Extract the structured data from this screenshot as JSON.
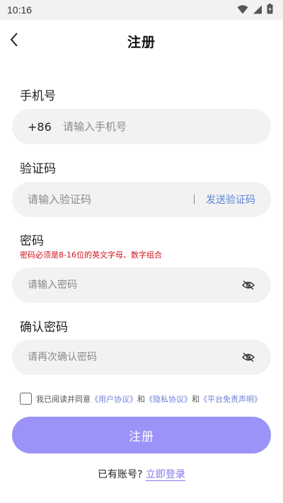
{
  "status_bar": {
    "time": "10:16",
    "icons": [
      "wifi-icon",
      "cellular-signal-icon",
      "battery-icon"
    ]
  },
  "header": {
    "title": "注册",
    "back_icon": "chevron-left-icon"
  },
  "phone": {
    "label": "手机号",
    "country_code": "+86",
    "placeholder": "请输入手机号",
    "value": ""
  },
  "code": {
    "label": "验证码",
    "placeholder": "请输入验证码",
    "value": "",
    "send_label": "发送验证码"
  },
  "password": {
    "label": "密码",
    "hint": "密码必须是8-16位的英文字母、数字组合",
    "placeholder": "请输入密码",
    "value": "",
    "toggle_icon": "eye-hidden-icon"
  },
  "confirm_password": {
    "label": "确认密码",
    "placeholder": "请再次确认密码",
    "value": "",
    "toggle_icon": "eye-hidden-icon"
  },
  "agreement": {
    "checked": false,
    "prefix": "我已阅读并同意",
    "user_agreement": "《用户协议》",
    "and_1": "和",
    "privacy": "《隐私协议》",
    "and_2": "和",
    "disclaimer": "《平台免责声明》"
  },
  "submit": {
    "label": "注册"
  },
  "login": {
    "prompt": "已有账号?",
    "link": "立即登录"
  },
  "colors": {
    "accent": "#9b93f7",
    "link": "#5a86d6",
    "error": "#d0121b",
    "field_bg": "#f2f2f2"
  }
}
